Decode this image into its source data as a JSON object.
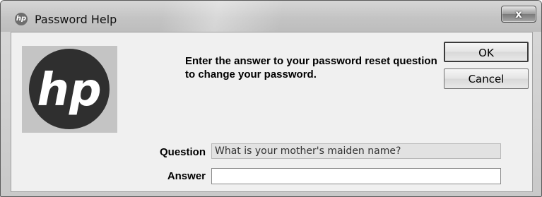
{
  "window": {
    "title": "Password Help",
    "close_glyph": "x",
    "app_icon": "hp-logo-icon"
  },
  "logo": {
    "text": "hp",
    "icon": "hp-logo-icon"
  },
  "instructions": "Enter the answer to your password reset question to change your password.",
  "buttons": {
    "ok_label": "OK",
    "cancel_label": "Cancel"
  },
  "form": {
    "question_label": "Question",
    "question_value": "What is your mother's maiden name?",
    "answer_label": "Answer",
    "answer_value": ""
  },
  "colors": {
    "logo_circle": "#2f2f2f",
    "logo_panel": "#c4c4c4",
    "dialog_background": "#f0f0f0"
  }
}
